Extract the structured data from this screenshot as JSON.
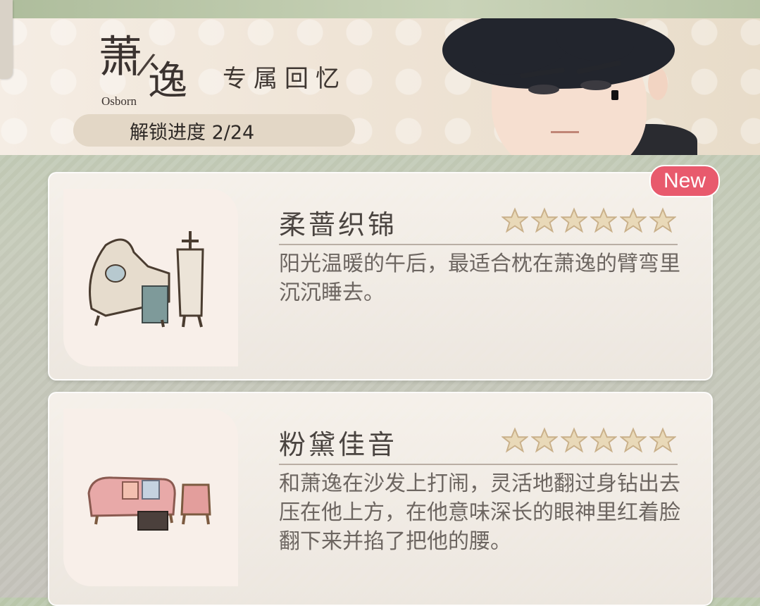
{
  "header": {
    "character_name": "萧逸",
    "character_name_first": "萧",
    "character_name_second": "逸",
    "character_name_en": "Osborn",
    "title": "专属回忆",
    "progress": "解锁进度 2/24"
  },
  "cards": [
    {
      "title": "柔蔷织锦",
      "description": "阳光温暖的午后，最适合枕在萧逸的臂弯里沉沉睡去。",
      "rarity_stars": 6,
      "badge": "New",
      "thumbnail_icon": "ornate-chaise-furniture-icon"
    },
    {
      "title": "粉黛佳音",
      "description": "和萧逸在沙发上打闹，灵活地翻过身钻出去压在他上方，在他意味深长的眼神里红着脸翻下来并掐了把他的腰。",
      "rarity_stars": 6,
      "thumbnail_icon": "pink-sofa-set-icon"
    }
  ],
  "colors": {
    "badge": "#e85a6d",
    "star_gold": "#d9c29a",
    "title_text": "#4a4440",
    "desc_text": "#6d6661"
  }
}
